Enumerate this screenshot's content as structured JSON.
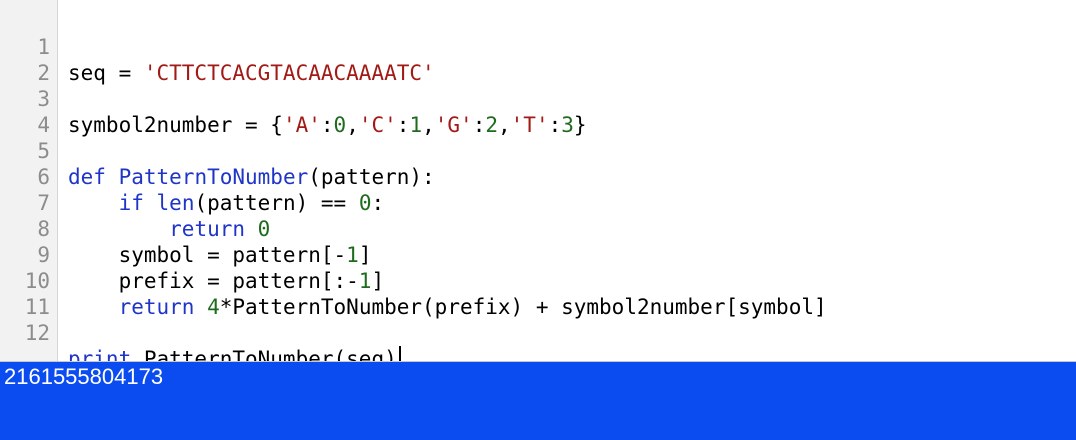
{
  "editor": {
    "line_numbers": [
      "1",
      "2",
      "3",
      "4",
      "5",
      "6",
      "7",
      "8",
      "9",
      "10",
      "11",
      "12"
    ],
    "lines": {
      "l1": {
        "t1": "seq = ",
        "t2": "'CTTCTCACGTACAACAAAATC'"
      },
      "l3": {
        "t1": "symbol2number = {",
        "t2": "'A'",
        "t3": ":",
        "t4": "0",
        "t5": ",",
        "t6": "'C'",
        "t7": ":",
        "t8": "1",
        "t9": ",",
        "t10": "'G'",
        "t11": ":",
        "t12": "2",
        "t13": ",",
        "t14": "'T'",
        "t15": ":",
        "t16": "3",
        "t17": "}"
      },
      "l5": {
        "t1": "def",
        "t2": " ",
        "t3": "PatternToNumber",
        "t4": "(pattern):"
      },
      "l6": {
        "t1": "    ",
        "t2": "if",
        "t3": " ",
        "t4": "len",
        "t5": "(pattern) == ",
        "t6": "0",
        "t7": ":"
      },
      "l7": {
        "t1": "        ",
        "t2": "return",
        "t3": " ",
        "t4": "0"
      },
      "l8": {
        "t1": "    symbol = pattern[-",
        "t2": "1",
        "t3": "]"
      },
      "l9": {
        "t1": "    prefix = pattern[:-",
        "t2": "1",
        "t3": "]"
      },
      "l10": {
        "t1": "    ",
        "t2": "return",
        "t3": " ",
        "t4": "4",
        "t5": "*PatternToNumber(prefix) + symbol2number[symbol]"
      },
      "l12": {
        "t1": "print",
        "t2": " PatternToNumber(seq)"
      }
    }
  },
  "output": {
    "text": "2161555804173"
  },
  "colors": {
    "keyword": "#1f35c8",
    "string": "#a21a16",
    "number": "#1e6b1e",
    "output_bg": "#0b4cf0"
  }
}
